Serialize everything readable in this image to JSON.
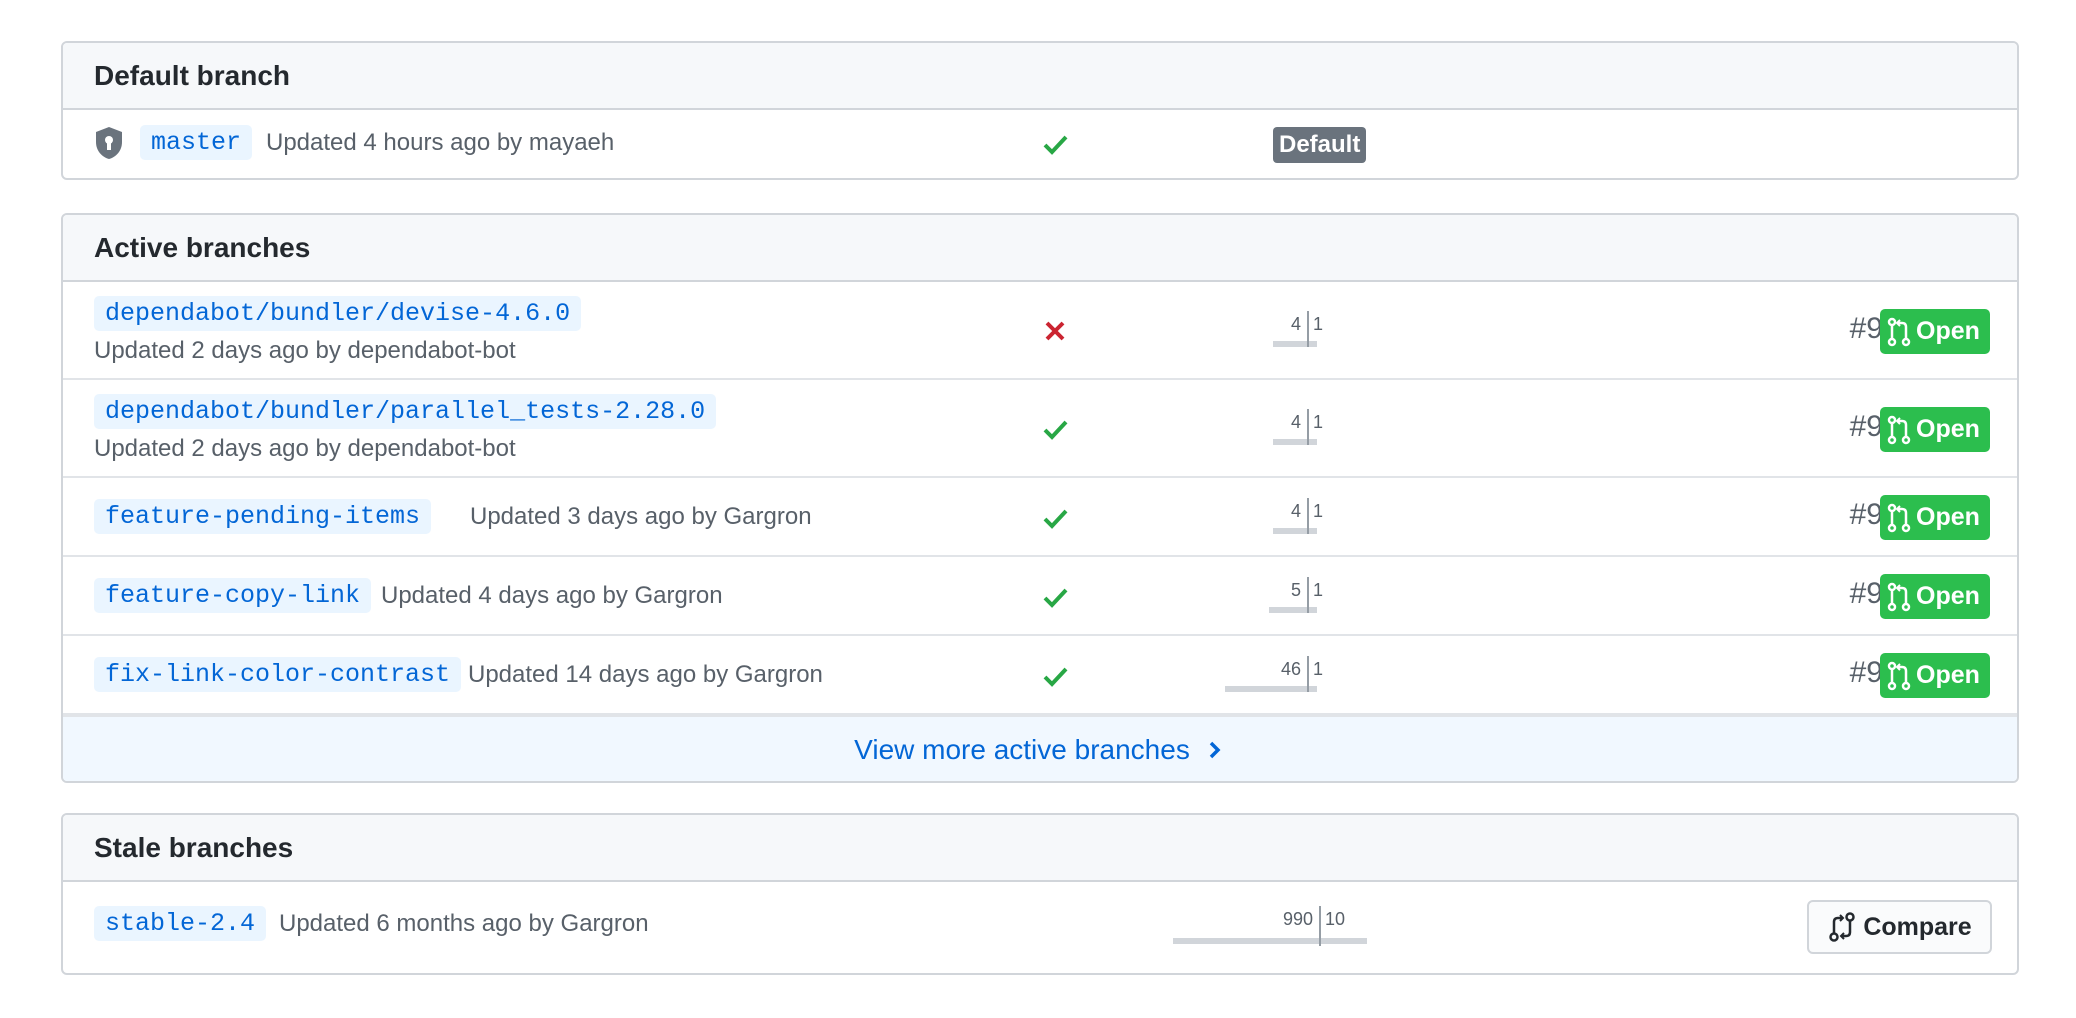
{
  "default_section": {
    "title": "Default branch",
    "branch": {
      "name": "master",
      "meta": "Updated 4 hours ago by mayaeh",
      "status": "success",
      "badge": "Default"
    }
  },
  "active_section": {
    "title": "Active branches",
    "branches": [
      {
        "name": "dependabot/bundler/devise-4.6.0",
        "meta": "Updated 2 days ago by dependabot-bot",
        "status": "failure",
        "behind": "4",
        "ahead": "1",
        "pr": "#9986",
        "pr_state": "Open"
      },
      {
        "name": "dependabot/bundler/parallel_tests-2.28.0",
        "meta": "Updated 2 days ago by dependabot-bot",
        "status": "success",
        "behind": "4",
        "ahead": "1",
        "pr": "#9985",
        "pr_state": "Open"
      },
      {
        "name": "feature-pending-items",
        "meta": "Updated 3 days ago by Gargron",
        "status": "success",
        "behind": "4",
        "ahead": "1",
        "pr": "#9984",
        "pr_state": "Open"
      },
      {
        "name": "feature-copy-link",
        "meta": "Updated 4 days ago by Gargron",
        "status": "success",
        "behind": "5",
        "ahead": "1",
        "pr": "#9983",
        "pr_state": "Open"
      },
      {
        "name": "fix-link-color-contrast",
        "meta": "Updated 14 days ago by Gargron",
        "status": "success",
        "behind": "46",
        "ahead": "1",
        "pr": "#9928",
        "pr_state": "Open"
      }
    ],
    "view_more": "View more active branches"
  },
  "stale_section": {
    "title": "Stale branches",
    "branch": {
      "name": "stable-2.4",
      "meta": "Updated 6 months ago by Gargron",
      "behind": "990",
      "ahead": "10",
      "compare_label": "Compare"
    }
  },
  "colors": {
    "success": "#28a745",
    "failure": "#cb2431",
    "open": "#2cbe4e",
    "link": "#0366d6"
  },
  "icons": {
    "shield": "shield-lock-icon",
    "check": "check-icon",
    "cross": "x-icon",
    "pr": "git-pull-request-icon",
    "chevron": "chevron-right-icon",
    "compare": "git-compare-icon"
  }
}
